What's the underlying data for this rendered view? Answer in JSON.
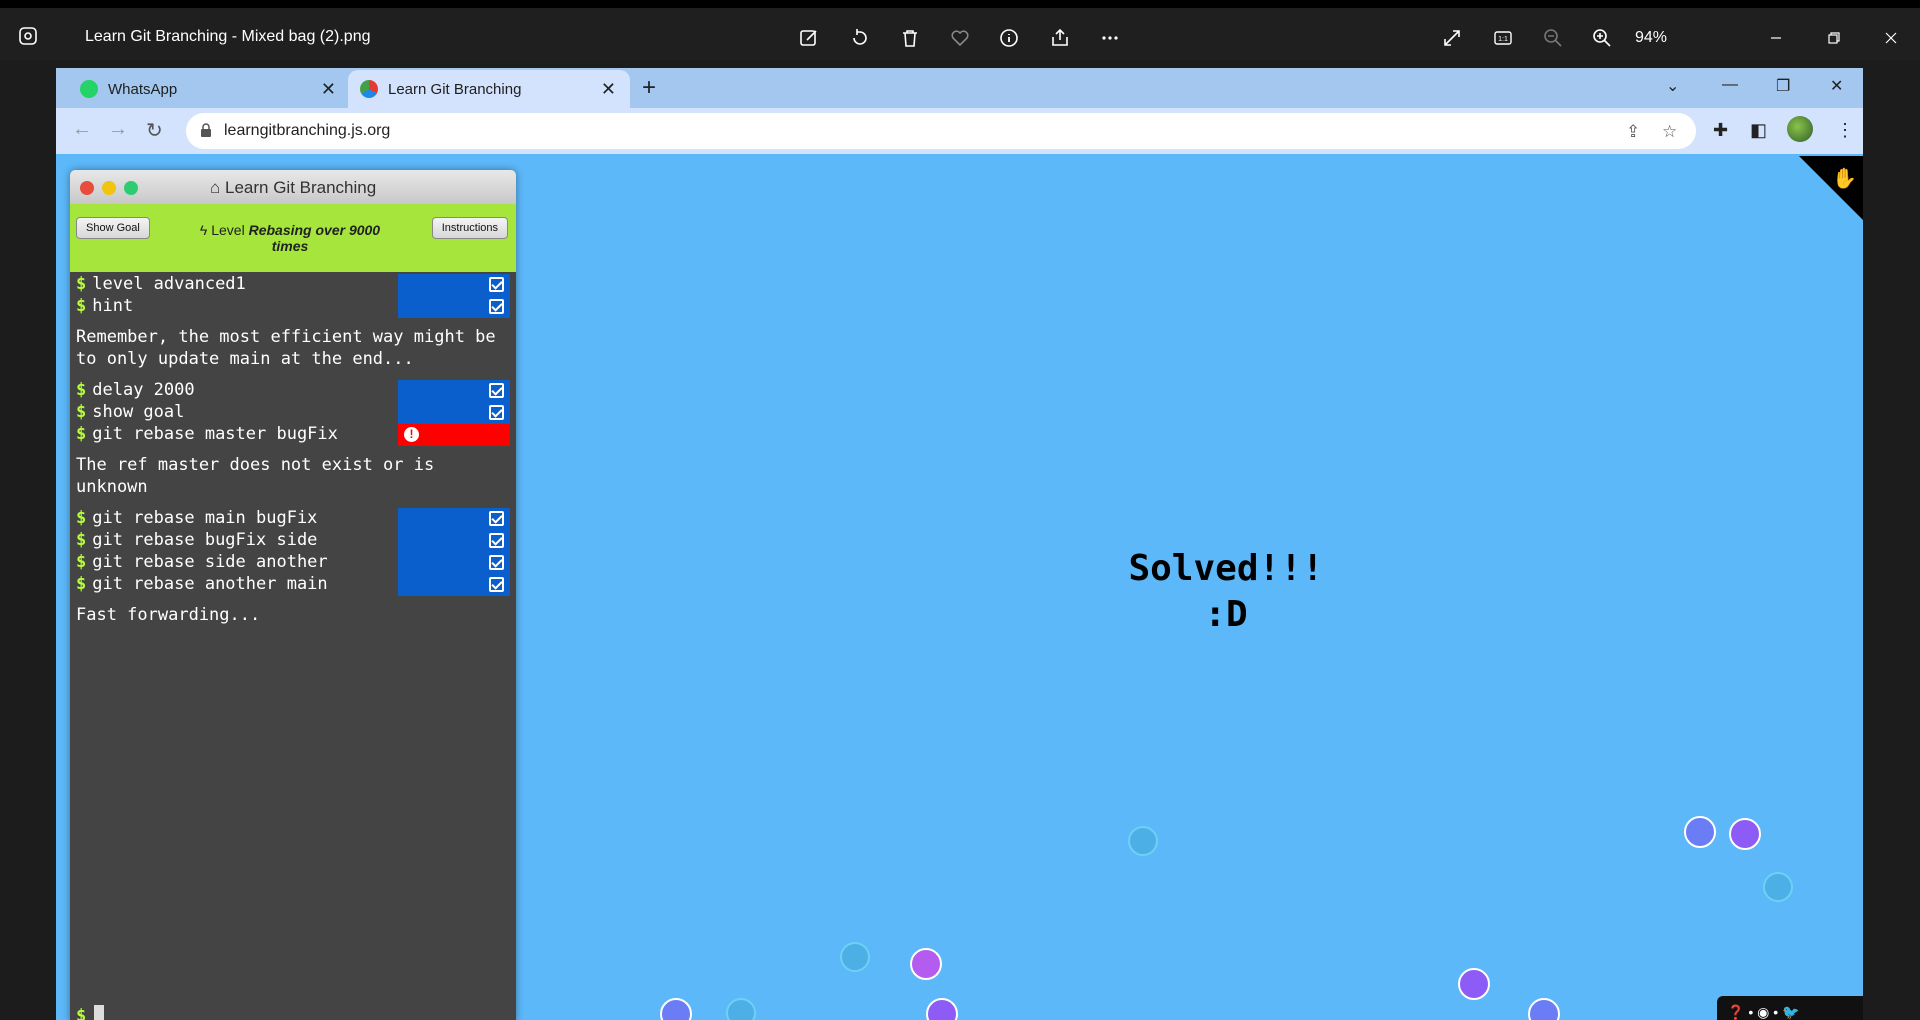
{
  "viewer": {
    "title": "Learn Git Branching - Mixed bag (2).png",
    "zoom": "94%"
  },
  "browser": {
    "tabs": [
      {
        "label": "WhatsApp",
        "active": false
      },
      {
        "label": "Learn Git Branching",
        "active": true
      }
    ],
    "url": "learngitbranching.js.org"
  },
  "terminal": {
    "title": "Learn Git Branching",
    "show_goal": "Show Goal",
    "instructions": "Instructions",
    "level_prefix": "Level",
    "level_name": "Rebasing over 9000 times",
    "prompt": "$",
    "commands": [
      {
        "text": "level advanced1",
        "status": "ok"
      },
      {
        "text": "hint",
        "status": "ok"
      },
      {
        "text": "delay 2000",
        "status": "ok"
      },
      {
        "text": "show goal",
        "status": "ok"
      },
      {
        "text": "git rebase master bugFix",
        "status": "error"
      },
      {
        "text": "git rebase main bugFix",
        "status": "ok"
      },
      {
        "text": "git rebase bugFix side",
        "status": "ok"
      },
      {
        "text": "git rebase side another",
        "status": "ok"
      },
      {
        "text": "git rebase another main",
        "status": "ok"
      }
    ],
    "messages": {
      "hint": "Remember, the most efficient way might be to only update main at the end...",
      "error": "The ref master does not exist or is unknown",
      "fast_forward": "Fast forwarding..."
    }
  },
  "canvas": {
    "solved_line1": "Solved!!!",
    "solved_line2": ":D",
    "colors": {
      "background": "#5cb8f9",
      "node_blue": "#6b7df5",
      "node_purple": "#8d5cf6",
      "node_magenta": "#b45cf0",
      "node_ghost": "#4cb0e6"
    }
  }
}
